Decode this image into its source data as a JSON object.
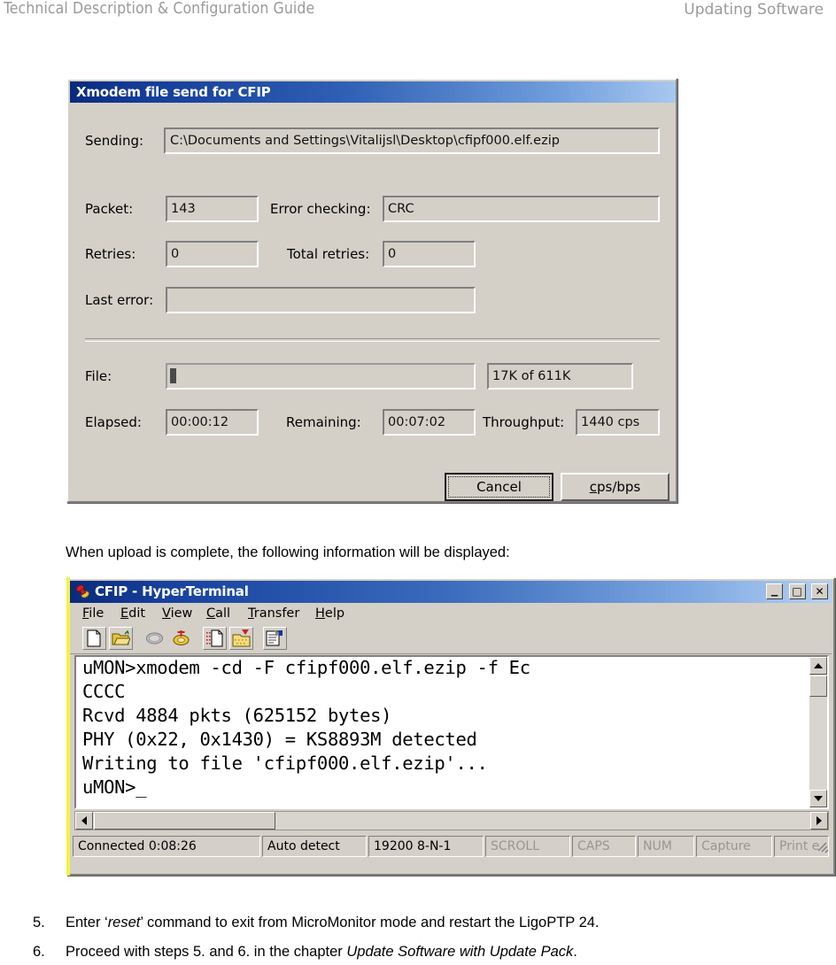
{
  "page_header": {
    "left": "Technical Description & Configuration Guide",
    "right": "Updating Software"
  },
  "xmodem_dialog": {
    "title": "Xmodem file send for CFIP",
    "fields": {
      "sending_label": "Sending:",
      "sending_value": "C:\\Documents and Settings\\Vitalijsl\\Desktop\\cfipf000.elf.ezip",
      "packet_label": "Packet:",
      "packet_value": "143",
      "error_checking_label": "Error checking:",
      "error_checking_value": "CRC",
      "retries_label": "Retries:",
      "retries_value": "0",
      "total_retries_label": "Total retries:",
      "total_retries_value": "0",
      "last_error_label": "Last error:",
      "last_error_value": "",
      "file_label": "File:",
      "file_progress_text": "17K of 611K",
      "elapsed_label": "Elapsed:",
      "elapsed_value": "00:00:12",
      "remaining_label": "Remaining:",
      "remaining_value": "00:07:02",
      "throughput_label": "Throughput:",
      "throughput_value": "1440 cps"
    },
    "buttons": {
      "cancel": "Cancel",
      "cps_bps_prefix": "c",
      "cps_bps_rest": "ps/bps"
    }
  },
  "intro_text": "When upload is complete, the following information will be displayed:",
  "hyperterminal": {
    "title": "CFIP - HyperTerminal",
    "window_buttons": {
      "minimize": "_",
      "maximize": "□",
      "close": "✕"
    },
    "menu": [
      {
        "first": "F",
        "rest": "ile"
      },
      {
        "first": "E",
        "rest": "dit"
      },
      {
        "first": "V",
        "rest": "iew"
      },
      {
        "first": "C",
        "rest": "all"
      },
      {
        "first": "T",
        "rest": "ransfer"
      },
      {
        "first": "H",
        "rest": "elp"
      }
    ],
    "toolbar_icons": [
      "new-connection-icon",
      "open-icon",
      "call-icon",
      "disconnect-icon",
      "send-file-icon",
      "receive-file-icon",
      "properties-icon"
    ],
    "terminal_lines": [
      "uMON>xmodem -cd -F cfipf000.elf.ezip -f Ec",
      "CCCC",
      "Rcvd 4884 pkts (625152 bytes)",
      "PHY (0x22, 0x1430) = KS8893M detected",
      "Writing to file 'cfipf000.elf.ezip'...",
      "uMON>_"
    ],
    "status_cells": [
      {
        "text": "Connected 0:08:26",
        "dim": false
      },
      {
        "text": "Auto detect",
        "dim": false
      },
      {
        "text": "19200 8-N-1",
        "dim": false
      },
      {
        "text": "SCROLL",
        "dim": true
      },
      {
        "text": "CAPS",
        "dim": true
      },
      {
        "text": "NUM",
        "dim": true
      },
      {
        "text": "Capture",
        "dim": true
      },
      {
        "text": "Print e",
        "dim": true
      }
    ]
  },
  "steps": [
    {
      "number": "5.",
      "pre": "Enter ‘",
      "italic": "reset",
      "post": "’ command to exit from MicroMonitor mode and restart the LigoPTP 24."
    },
    {
      "number": "6.",
      "pre": "Proceed with steps 5. and 6. in the chapter ",
      "italic": "Update Software with Update Pack",
      "post": "."
    }
  ],
  "colors": {
    "dialog_face": "#d4d0c8",
    "title_start": "#0a2a7a",
    "title_end": "#b4d0f2",
    "header_gray": "#9a9a9a"
  }
}
